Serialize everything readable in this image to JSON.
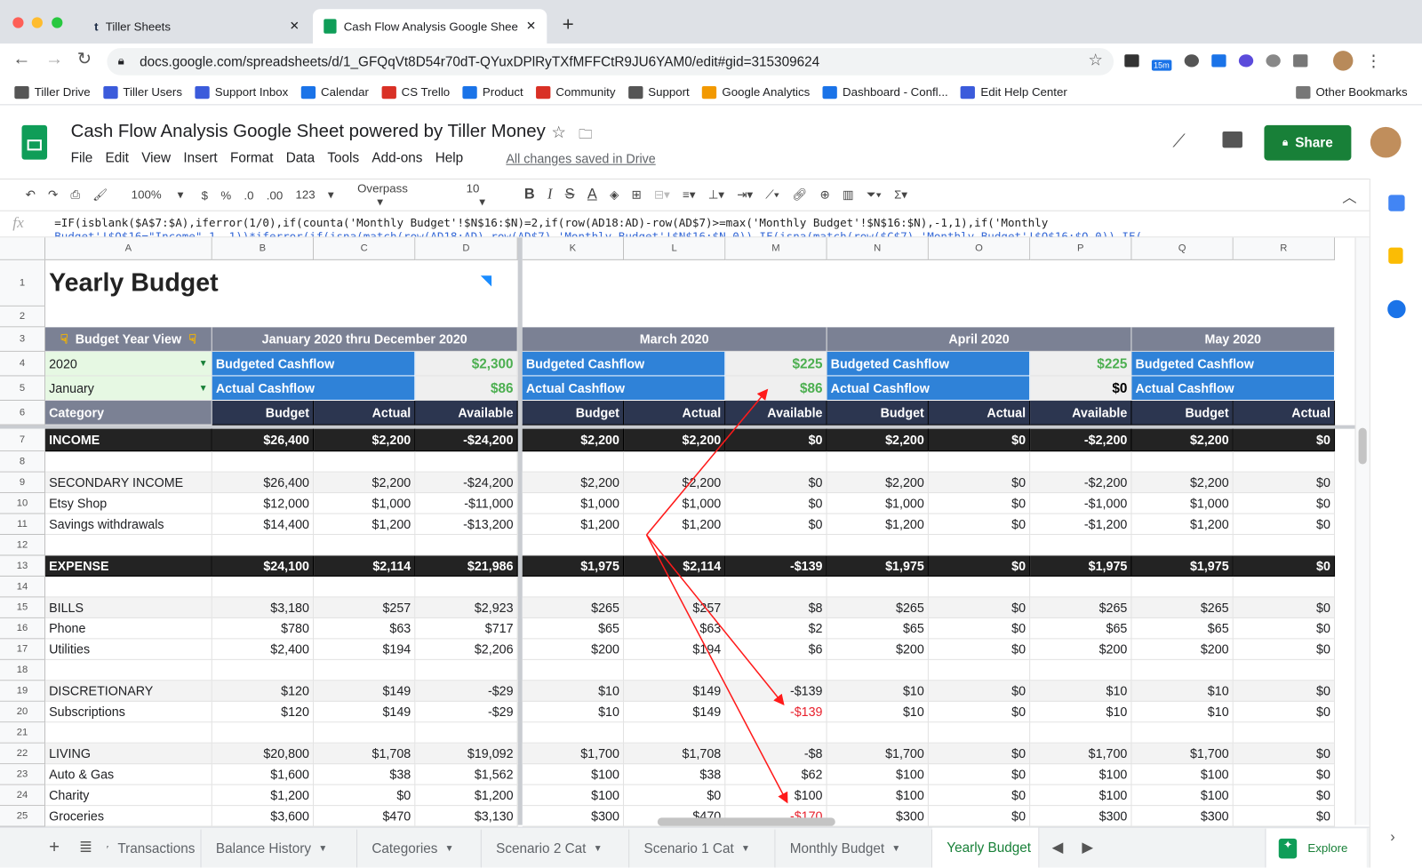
{
  "browser": {
    "tabs": [
      {
        "title": "Tiller Sheets",
        "active": false
      },
      {
        "title": "Cash Flow Analysis Google Shee",
        "active": true
      }
    ],
    "url": "docs.google.com/spreadsheets/d/1_GFQqVt8D54r70dT-QYuxDPlRyTXfMFFCtR9JU6YAM0/edit#gid=315309624",
    "extension_badge": "15m",
    "bookmarks": [
      "Tiller Drive",
      "Tiller Users",
      "Support Inbox",
      "Calendar",
      "CS Trello",
      "Product",
      "Community",
      "Support",
      "Google Analytics",
      "Dashboard - Confl...",
      "Edit Help Center"
    ],
    "other_bookmarks": "Other Bookmarks"
  },
  "doc": {
    "title": "Cash Flow Analysis Google Sheet powered by Tiller Money",
    "menu": [
      "File",
      "Edit",
      "View",
      "Insert",
      "Format",
      "Data",
      "Tools",
      "Add-ons",
      "Help"
    ],
    "save_status": "All changes saved in Drive",
    "share_label": "Share",
    "accent": "#188038"
  },
  "toolbar": {
    "zoom": "100%",
    "currency": "$",
    "percent": "%",
    "dec_less": ".0",
    "dec_more": ".00",
    "more_formats": "123",
    "font": "Overpass",
    "font_size": "10"
  },
  "formula": {
    "fx": "fx",
    "line1": "=IF(isblank($A$7:$A),iferror(1/0),if(counta('Monthly Budget'!$N$16:$N)=2,if(row(AD18:AD)-row(AD$7)>=max('Monthly Budget'!$N$16:$N),-1,1),if('Monthly",
    "line2": "Budget'!$O$16=\"Income\",1,-1))*iferror(if(isna(match(row(AD18:AD)-row(AD$7),'Monthly Budget'!$N$16:$N,0)),IF(isna(match(row($C$7),'Monthly Budget'!$O$16:$O,0)),IF("
  },
  "sheet": {
    "columns": [
      "A",
      "B",
      "C",
      "D",
      "K",
      "L",
      "M",
      "N",
      "O",
      "P",
      "Q",
      "R"
    ],
    "title": "Yearly Budget",
    "logo_letter": "t",
    "header": {
      "year_view": "Budget Year View",
      "range": "January 2020 thru December 2020",
      "months": [
        "March 2020",
        "April 2020",
        "May 2020"
      ],
      "year_value": "2020",
      "month_value": "January",
      "budgeted_label": "Budgeted Cashflow",
      "actual_label": "Actual Cashflow",
      "budgeted_values": [
        "$2,300",
        "$225",
        "$225"
      ],
      "actual_values": [
        "$86",
        "$86",
        "$0"
      ],
      "category": "Category",
      "col_heads": [
        "Budget",
        "Actual",
        "Available",
        "Budget",
        "Actual",
        "Available",
        "Budget",
        "Actual",
        "Available",
        "Budget",
        "Actual"
      ]
    },
    "rows": [
      {
        "n": 7,
        "type": "total",
        "cells": [
          "INCOME",
          "$26,400",
          "$2,200",
          "-$24,200",
          "$2,200",
          "$2,200",
          "$0",
          "$2,200",
          "$0",
          "-$2,200",
          "$2,200",
          "$0"
        ]
      },
      {
        "n": 8,
        "type": "blank",
        "cells": []
      },
      {
        "n": 9,
        "type": "group",
        "cells": [
          "SECONDARY INCOME",
          "$26,400",
          "$2,200",
          "-$24,200",
          "$2,200",
          "$2,200",
          "$0",
          "$2,200",
          "$0",
          "-$2,200",
          "$2,200",
          "$0"
        ]
      },
      {
        "n": 10,
        "type": "item",
        "cells": [
          "Etsy Shop",
          "$12,000",
          "$1,000",
          "-$11,000",
          "$1,000",
          "$1,000",
          "$0",
          "$1,000",
          "$0",
          "-$1,000",
          "$1,000",
          "$0"
        ]
      },
      {
        "n": 11,
        "type": "item",
        "cells": [
          "Savings withdrawals",
          "$14,400",
          "$1,200",
          "-$13,200",
          "$1,200",
          "$1,200",
          "$0",
          "$1,200",
          "$0",
          "-$1,200",
          "$1,200",
          "$0"
        ]
      },
      {
        "n": 12,
        "type": "blank",
        "cells": []
      },
      {
        "n": 13,
        "type": "total",
        "cells": [
          "EXPENSE",
          "$24,100",
          "$2,114",
          "$21,986",
          "$1,975",
          "$2,114",
          "-$139",
          "$1,975",
          "$0",
          "$1,975",
          "$1,975",
          "$0"
        ]
      },
      {
        "n": 14,
        "type": "blank",
        "cells": []
      },
      {
        "n": 15,
        "type": "group",
        "cells": [
          "BILLS",
          "$3,180",
          "$257",
          "$2,923",
          "$265",
          "$257",
          "$8",
          "$265",
          "$0",
          "$265",
          "$265",
          "$0"
        ]
      },
      {
        "n": 16,
        "type": "item",
        "cells": [
          "Phone",
          "$780",
          "$63",
          "$717",
          "$65",
          "$63",
          "$2",
          "$65",
          "$0",
          "$65",
          "$65",
          "$0"
        ]
      },
      {
        "n": 17,
        "type": "item",
        "cells": [
          "Utilities",
          "$2,400",
          "$194",
          "$2,206",
          "$200",
          "$194",
          "$6",
          "$200",
          "$0",
          "$200",
          "$200",
          "$0"
        ]
      },
      {
        "n": 18,
        "type": "blank",
        "cells": []
      },
      {
        "n": 19,
        "type": "group",
        "cells": [
          "DISCRETIONARY",
          "$120",
          "$149",
          "-$29",
          "$10",
          "$149",
          "-$139",
          "$10",
          "$0",
          "$10",
          "$10",
          "$0"
        ]
      },
      {
        "n": 20,
        "type": "item",
        "red": [
          6
        ],
        "cells": [
          "Subscriptions",
          "$120",
          "$149",
          "-$29",
          "$10",
          "$149",
          "-$139",
          "$10",
          "$0",
          "$10",
          "$10",
          "$0"
        ]
      },
      {
        "n": 21,
        "type": "blank",
        "cells": []
      },
      {
        "n": 22,
        "type": "group",
        "cells": [
          "LIVING",
          "$20,800",
          "$1,708",
          "$19,092",
          "$1,700",
          "$1,708",
          "-$8",
          "$1,700",
          "$0",
          "$1,700",
          "$1,700",
          "$0"
        ]
      },
      {
        "n": 23,
        "type": "item",
        "cells": [
          "Auto & Gas",
          "$1,600",
          "$38",
          "$1,562",
          "$100",
          "$38",
          "$62",
          "$100",
          "$0",
          "$100",
          "$100",
          "$0"
        ]
      },
      {
        "n": 24,
        "type": "item",
        "cells": [
          "Charity",
          "$1,200",
          "$0",
          "$1,200",
          "$100",
          "$0",
          "$100",
          "$100",
          "$0",
          "$100",
          "$100",
          "$0"
        ]
      },
      {
        "n": 25,
        "type": "item",
        "red": [
          6
        ],
        "cells": [
          "Groceries",
          "$3,600",
          "$470",
          "$3,130",
          "$300",
          "$470",
          "-$170",
          "$300",
          "$0",
          "$300",
          "$300",
          "$0"
        ]
      }
    ],
    "colors": {
      "header_gray": "#7b8194",
      "blue": "#2f82d8",
      "navy": "#2c3650",
      "total": "#232323",
      "group": "#f3f3f3",
      "input_green": "#e6f8e3",
      "positive": "#4caf50",
      "negative": "#e8212d",
      "annotation": "#ff1a1a"
    }
  },
  "sheet_tabs": [
    "Transactions",
    "Balance History",
    "Categories",
    "Scenario 2 Cat",
    "Scenario 1 Cat",
    "Monthly Budget",
    "Yearly Budget"
  ],
  "active_tab": "Yearly Budget",
  "explore_label": "Explore"
}
